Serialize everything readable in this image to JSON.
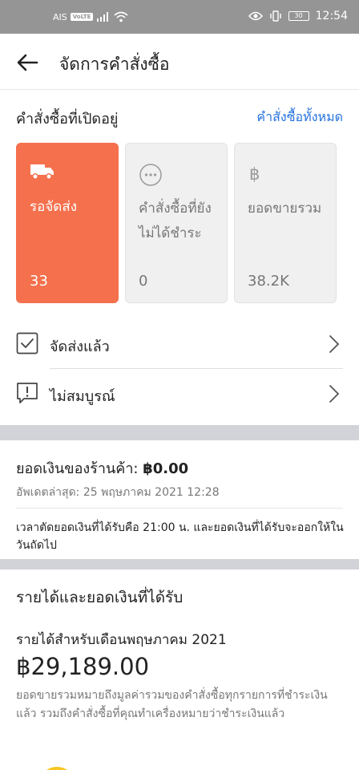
{
  "status_bar": {
    "carrier": "AIS",
    "volte": "VoLTE",
    "battery": "30",
    "time": "12:54"
  },
  "header": {
    "title": "จัดการคำสั่งซื้อ"
  },
  "orders": {
    "title": "คำสั่งซื้อที่เปิดอยู่",
    "all_link": "คำสั่งซื้อทั้งหมด",
    "cards": [
      {
        "label": "รอจัดส่ง",
        "value": "33",
        "icon": "truck-icon"
      },
      {
        "label": "คำสั่งซื้อที่ยังไม่ได้ชำระ",
        "value": "0",
        "icon": "more-dots-icon"
      },
      {
        "label": "ยอดขายรวม",
        "value": "38.2K",
        "icon": "baht-icon"
      }
    ],
    "rows": [
      {
        "label": "จัดส่งแล้ว",
        "icon": "checkbox-icon"
      },
      {
        "label": "ไม่สมบูรณ์",
        "icon": "alert-box-icon"
      }
    ]
  },
  "balance": {
    "title": "ยอดเงินของร้านค้า:",
    "amount": "฿0.00",
    "updated": "อัพเดตล่าสุด: 25 พฤษภาคม 2021 12:28",
    "note": "เวลาตัดยอดเงินที่ได้รับคือ 21:00 น. และยอดเงินที่ได้รับจะออกให้ในวันถัดไป"
  },
  "income": {
    "title": "รายได้และยอดเงินที่ได้รับ",
    "month_label": "รายได้สำหรับเดือนพฤษภาคม 2021",
    "amount": "฿29,189.00",
    "description": "ยอดขายรวมหมายถึงมูลค่ารวมของคำสั่งซื้อทุกรายการที่ชำระเงินแล้ว รวมถึงคำสั่งซื้อที่คุณทำเครื่องหมายว่าชำระเงินแล้ว"
  },
  "colors": {
    "accent": "#f5704d",
    "link": "#2673dd",
    "status_bar": "#959595",
    "band": "#d1d3d8"
  }
}
